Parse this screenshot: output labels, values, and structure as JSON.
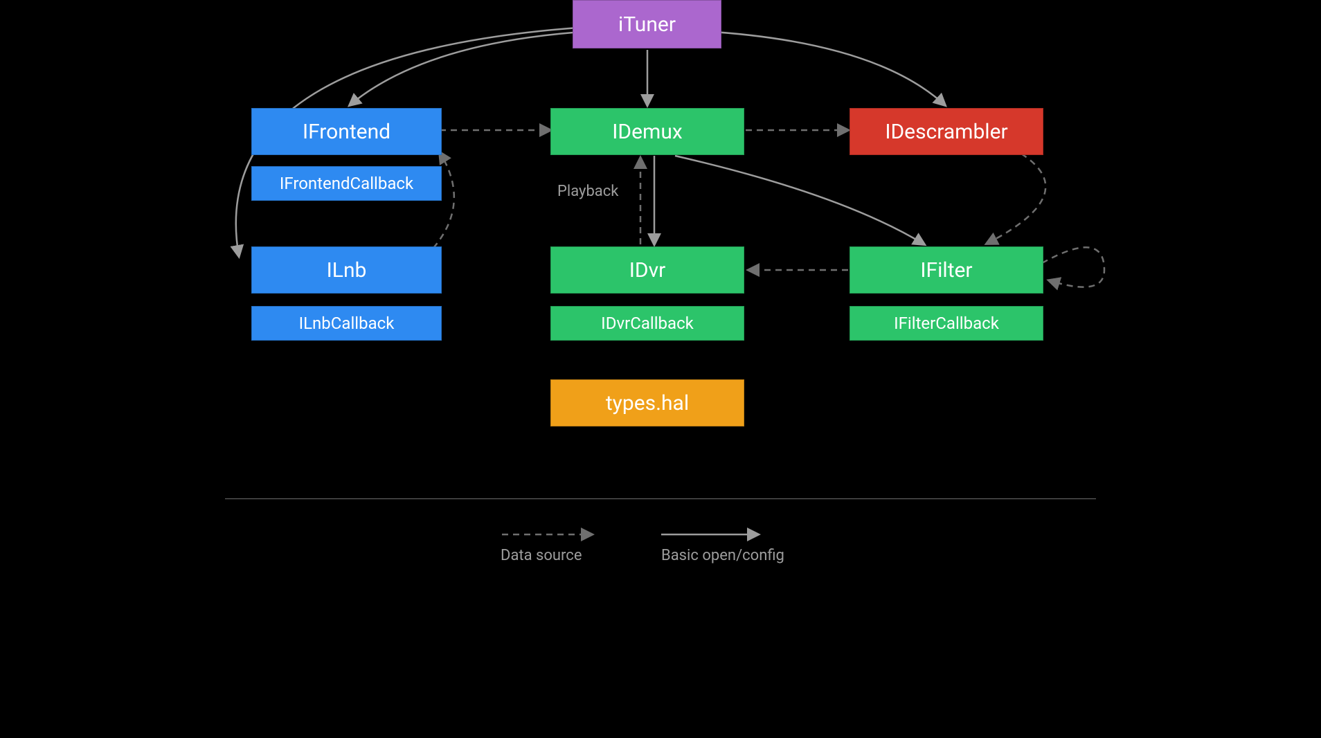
{
  "nodes": {
    "ituner": "iTuner",
    "ifrontend": "IFrontend",
    "ifrontend_cb": "IFrontendCallback",
    "idemux": "IDemux",
    "idescrambler": "IDescrambler",
    "ilnb": "ILnb",
    "ilnb_cb": "ILnbCallback",
    "idvr": "IDvr",
    "idvr_cb": "IDvrCallback",
    "ifilter": "IFilter",
    "ifilter_cb": "IFilterCallback",
    "types_hal": "types.hal"
  },
  "labels": {
    "playback": "Playback"
  },
  "legend": {
    "data_source": "Data source",
    "basic_open": "Basic open/config"
  },
  "colors": {
    "purple": "#ab67ce",
    "blue": "#2e8af1",
    "green": "#2cc46a",
    "red": "#d6382b",
    "orange": "#f0a019"
  }
}
